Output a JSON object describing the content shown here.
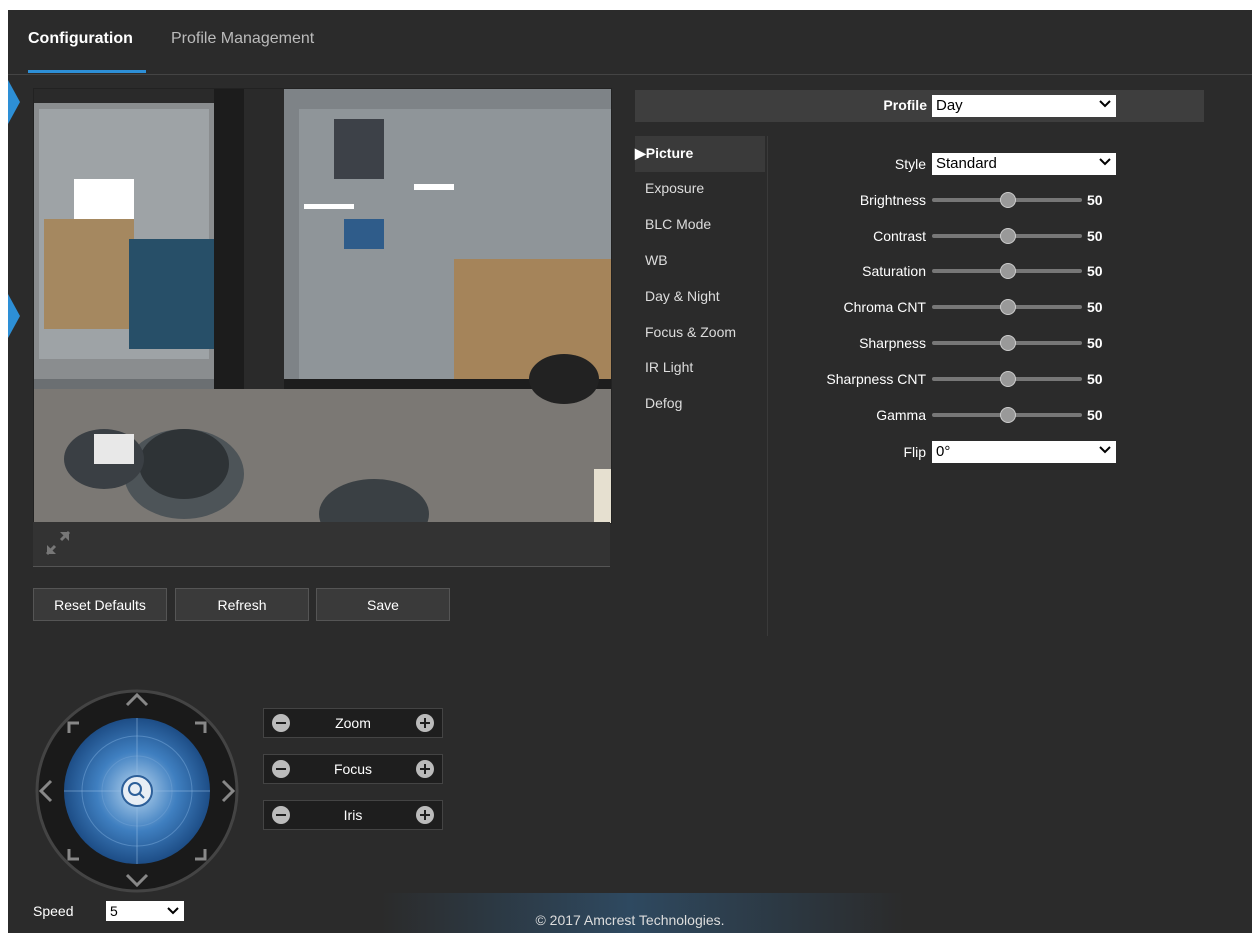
{
  "tabs": [
    {
      "label": "Configuration",
      "active": true
    },
    {
      "label": "Profile Management",
      "active": false
    }
  ],
  "video_controls": {
    "fullscreen_icon": "expand-arrows-icon"
  },
  "actions": {
    "reset_defaults": "Reset Defaults",
    "refresh": "Refresh",
    "save": "Save"
  },
  "profile": {
    "label": "Profile",
    "value": "Day"
  },
  "menu": {
    "items": [
      "Picture",
      "Exposure",
      "BLC Mode",
      "WB",
      "Day & Night",
      "Focus & Zoom",
      "IR Light",
      "Defog"
    ],
    "active": "Picture"
  },
  "picture": {
    "style": {
      "label": "Style",
      "value": "Standard"
    },
    "sliders": [
      {
        "label": "Brightness",
        "value": "50"
      },
      {
        "label": "Contrast",
        "value": "50"
      },
      {
        "label": "Saturation",
        "value": "50"
      },
      {
        "label": "Chroma CNT",
        "value": "50"
      },
      {
        "label": "Sharpness",
        "value": "50"
      },
      {
        "label": "Sharpness CNT",
        "value": "50"
      },
      {
        "label": "Gamma",
        "value": "50"
      }
    ],
    "flip": {
      "label": "Flip",
      "value": "0°"
    }
  },
  "ptz": {
    "controls": [
      {
        "label": "Zoom"
      },
      {
        "label": "Focus"
      },
      {
        "label": "Iris"
      }
    ],
    "speed": {
      "label": "Speed",
      "value": "5"
    }
  },
  "footer": {
    "text": "© 2017 Amcrest Technologies."
  },
  "colors": {
    "accent": "#2d8fd6",
    "background": "#2b2b2b",
    "panel": "#3e3e3e"
  }
}
